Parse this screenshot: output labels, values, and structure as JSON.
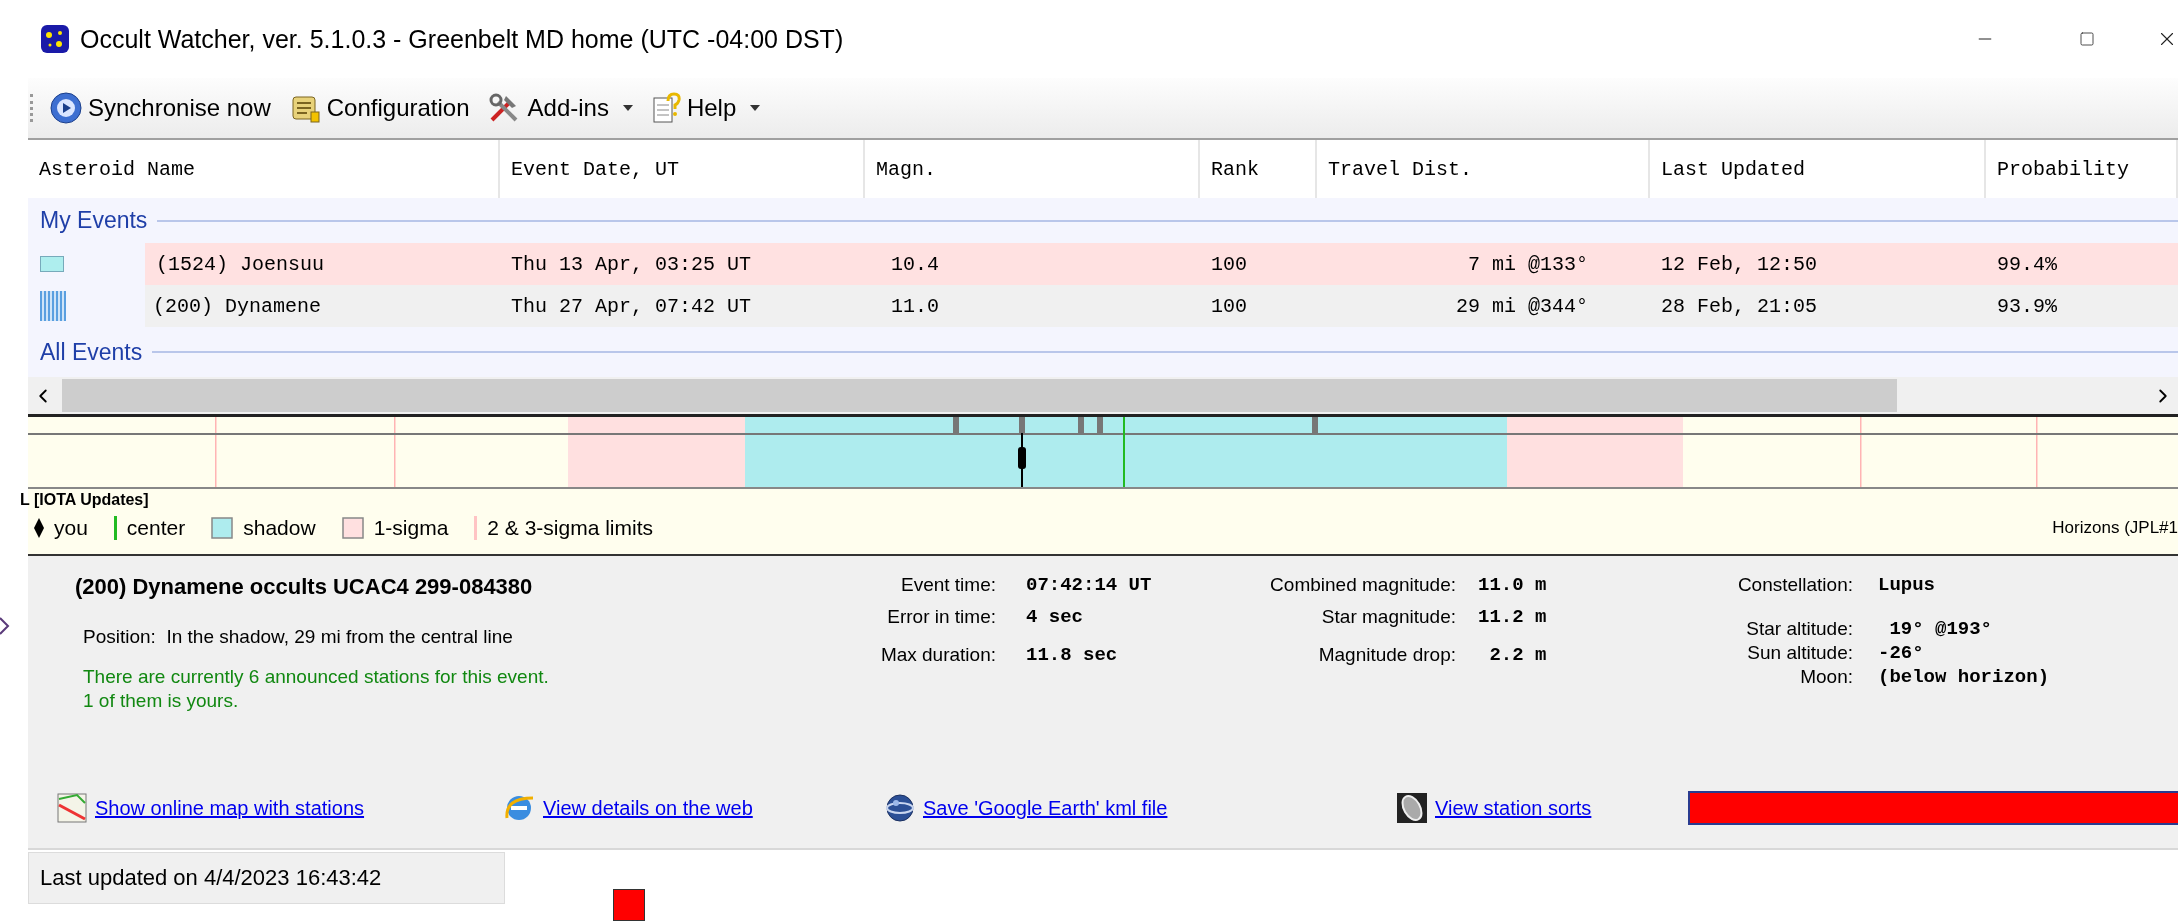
{
  "window": {
    "title": "Occult Watcher, ver. 5.1.0.3 - Greenbelt MD home (UTC -04:00 DST)"
  },
  "toolbar": [
    {
      "kind": "sync",
      "label": "Synchronise now",
      "dropdown": false
    },
    {
      "kind": "config",
      "label": "Configuration",
      "dropdown": false
    },
    {
      "kind": "addins",
      "label": "Add-ins",
      "dropdown": true
    },
    {
      "kind": "help",
      "label": "Help",
      "dropdown": true
    }
  ],
  "table": {
    "columns": [
      "Asteroid Name",
      "Event Date, UT",
      "Magn.",
      "Rank",
      "Travel Dist.",
      "Last Updated",
      "Probability"
    ],
    "groups": [
      {
        "label": "My Events",
        "rows": [
          {
            "selected": false,
            "color": "#ffe1e1",
            "cells": [
              "(1524) Joensuu",
              "Thu 13 Apr, 03:25 UT",
              "10.4",
              "100",
              "7 mi @133°",
              "12 Feb, 12:50",
              "99.4%"
            ]
          },
          {
            "selected": true,
            "color": "#f0f0f0",
            "cells": [
              "(200) Dynamene",
              "Thu 27 Apr, 07:42 UT",
              "11.0",
              "100",
              "29 mi @344°",
              "28 Feb, 21:05",
              "93.9%"
            ]
          }
        ]
      },
      {
        "label": "All Events"
      }
    ]
  },
  "strip": {
    "source": "L [IOTA Updates]",
    "ephemeris": "Horizons (JPL#1",
    "legend": [
      {
        "kind": "marker",
        "label": "you",
        "color": "#000000"
      },
      {
        "kind": "line",
        "label": "center",
        "color": "#22bb22"
      },
      {
        "kind": "swatch",
        "label": "shadow",
        "color": "#aeecee"
      },
      {
        "kind": "swatch",
        "label": "1-sigma",
        "color": "#ffe0e0"
      },
      {
        "kind": "line",
        "label": "2 & 3-sigma limits",
        "color": "#ffc4c4"
      }
    ]
  },
  "details": {
    "title": "(200) Dynamene occults UCAC4 299-084380",
    "position_label": "Position:",
    "position": "In the shadow, 29 mi from the central line",
    "note": [
      "There are currently 6 announced stations for this event.",
      "1 of them is yours."
    ],
    "columns": [
      [
        [
          {
            "label": "Event time:",
            "value": "07:42:14 UT"
          },
          {
            "label": "Error in time:",
            "value": "4 sec"
          }
        ],
        [
          {
            "label": "Max duration:",
            "value": "11.8 sec"
          }
        ]
      ],
      [
        [
          {
            "label": "Combined magnitude:",
            "value": "11.0 m"
          },
          {
            "label": "Star magnitude:",
            "value": "11.2 m"
          }
        ],
        [
          {
            "label": "Magnitude drop:",
            "value": " 2.2 m"
          }
        ]
      ],
      [
        [
          {
            "label": "Constellation:",
            "value": "Lupus"
          }
        ],
        [
          {
            "label": "Star altitude:",
            "value": " 19° @193°"
          },
          {
            "label": "Sun altitude:",
            "value": "-26°"
          },
          {
            "label": "Moon:",
            "value": "(below horizon)"
          }
        ]
      ]
    ],
    "links": [
      {
        "kind": "map",
        "label": "Show online map with stations"
      },
      {
        "kind": "web",
        "label": "View details on the web"
      },
      {
        "kind": "earth",
        "label": "Save 'Google Earth' kml file"
      },
      {
        "kind": "sorts",
        "label": "View station sorts"
      }
    ]
  },
  "status_bar": {
    "text": "Last updated on 4/4/2023 16:43:42"
  }
}
